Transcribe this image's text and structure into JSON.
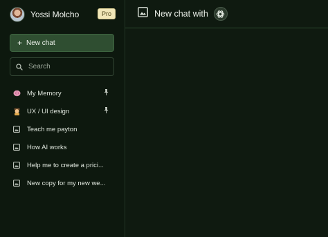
{
  "user": {
    "name": "Yossi Molcho",
    "badge": "Pro"
  },
  "sidebar": {
    "new_chat_label": "New chat",
    "search_placeholder": "Search",
    "items": [
      {
        "label": "My Memory",
        "icon": "brain-icon",
        "pinned": true
      },
      {
        "label": "UX / UI design",
        "icon": "designer-emoji-icon",
        "pinned": true
      },
      {
        "label": "Teach me payton",
        "icon": "image-icon",
        "pinned": false
      },
      {
        "label": "How AI works",
        "icon": "image-icon",
        "pinned": false
      },
      {
        "label": "Help me to create a prici...",
        "icon": "image-icon",
        "pinned": false
      },
      {
        "label": "New copy for my new we...",
        "icon": "image-icon",
        "pinned": false
      }
    ]
  },
  "main": {
    "title": "New chat with",
    "model_icon": "openai-logo-icon"
  },
  "colors": {
    "background": "#0f1a10",
    "accent": "#2f4e31",
    "badge": "#f1e7b8"
  }
}
